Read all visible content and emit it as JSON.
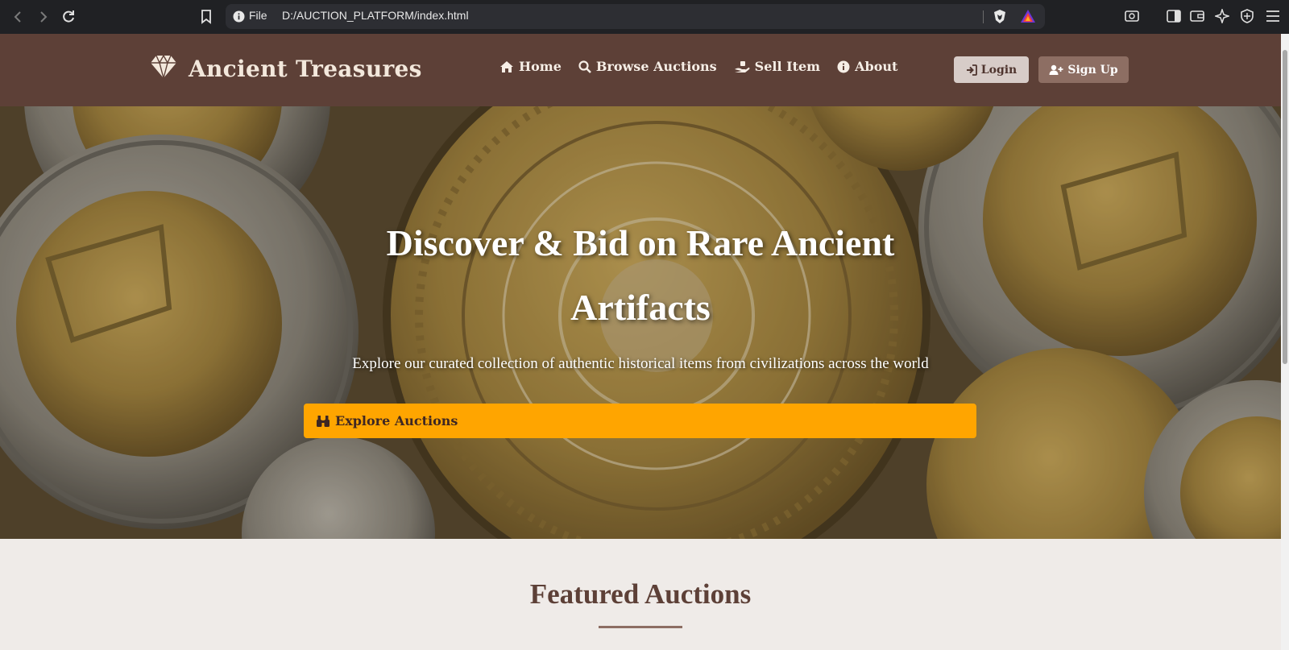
{
  "browser": {
    "scheme_label": "File",
    "url": "D:/AUCTION_PLATFORM/index.html"
  },
  "header": {
    "brand_first": "Ancient",
    "brand_second": "Treasures",
    "nav": [
      {
        "label": "Home",
        "icon": "home-icon"
      },
      {
        "label": "Browse Auctions",
        "icon": "search-icon"
      },
      {
        "label": "Sell Item",
        "icon": "hand-holding-icon"
      },
      {
        "label": "About",
        "icon": "info-circle-icon"
      }
    ],
    "login_label": "Login",
    "signup_label": "Sign Up"
  },
  "hero": {
    "title_line1": "Discover & Bid on Rare Ancient",
    "title_line2": "Artifacts",
    "subtitle": "Explore our curated collection of authentic historical items from civilizations across the world",
    "cta_label": "Explore Auctions"
  },
  "featured": {
    "title": "Featured Auctions"
  },
  "colors": {
    "header_bg": "#5d4037",
    "accent_cta": "#ffa500",
    "login_bg": "#d7ccc8",
    "signup_bg": "#8d6e63",
    "page_bg": "#efebe8",
    "heading": "#5d4037"
  }
}
